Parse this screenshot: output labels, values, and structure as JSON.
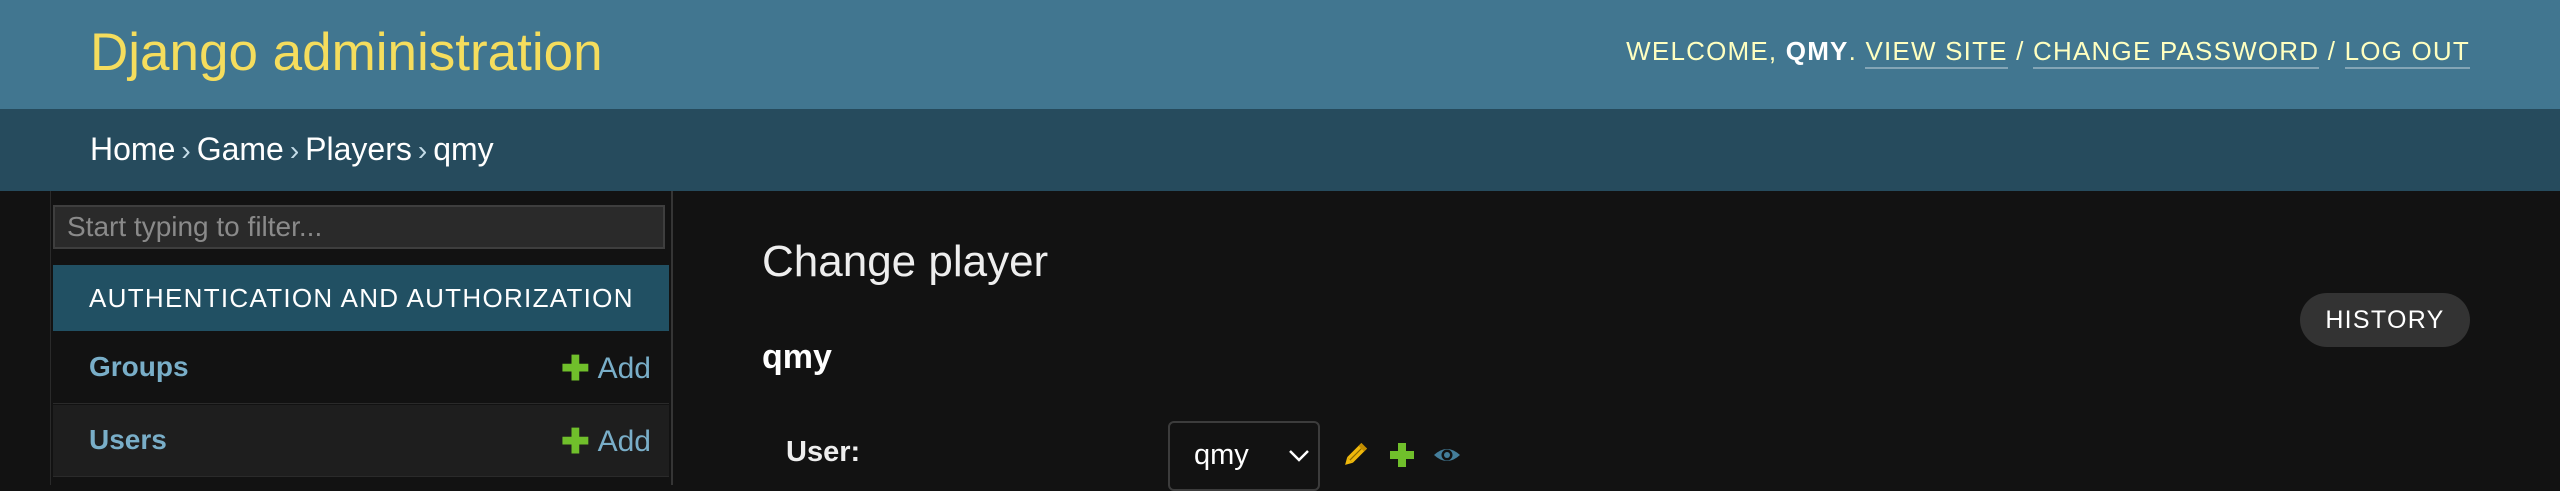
{
  "header": {
    "site_title": "Django administration",
    "welcome": "WELCOME,",
    "username": "QMY",
    "dot": ".",
    "view_site": "VIEW SITE",
    "change_password": "CHANGE PASSWORD",
    "log_out": "LOG OUT",
    "separator": "/"
  },
  "breadcrumbs": {
    "items": [
      "Home",
      "Game",
      "Players"
    ],
    "current": "qmy",
    "arrow": "›"
  },
  "sidebar": {
    "filter_placeholder": "Start typing to filter...",
    "app_caption": "AUTHENTICATION AND AUTHORIZATION",
    "models": [
      {
        "name": "Groups",
        "add_label": "Add"
      },
      {
        "name": "Users",
        "add_label": "Add"
      }
    ]
  },
  "content": {
    "title": "Change player",
    "object_title": "qmy",
    "history_label": "HISTORY",
    "fields": {
      "user_label": "User:",
      "user_value": "qmy"
    },
    "related_icons": [
      "pencil-icon",
      "plus-icon",
      "eye-icon"
    ]
  },
  "colors": {
    "header_bg": "#417690",
    "breadcrumb_bg": "#264b5d",
    "site_title": "#f5dd5d",
    "link": "#79aec8",
    "add_green": "#70bf2b",
    "caption_bg": "#215063",
    "body_bg": "#121212"
  }
}
